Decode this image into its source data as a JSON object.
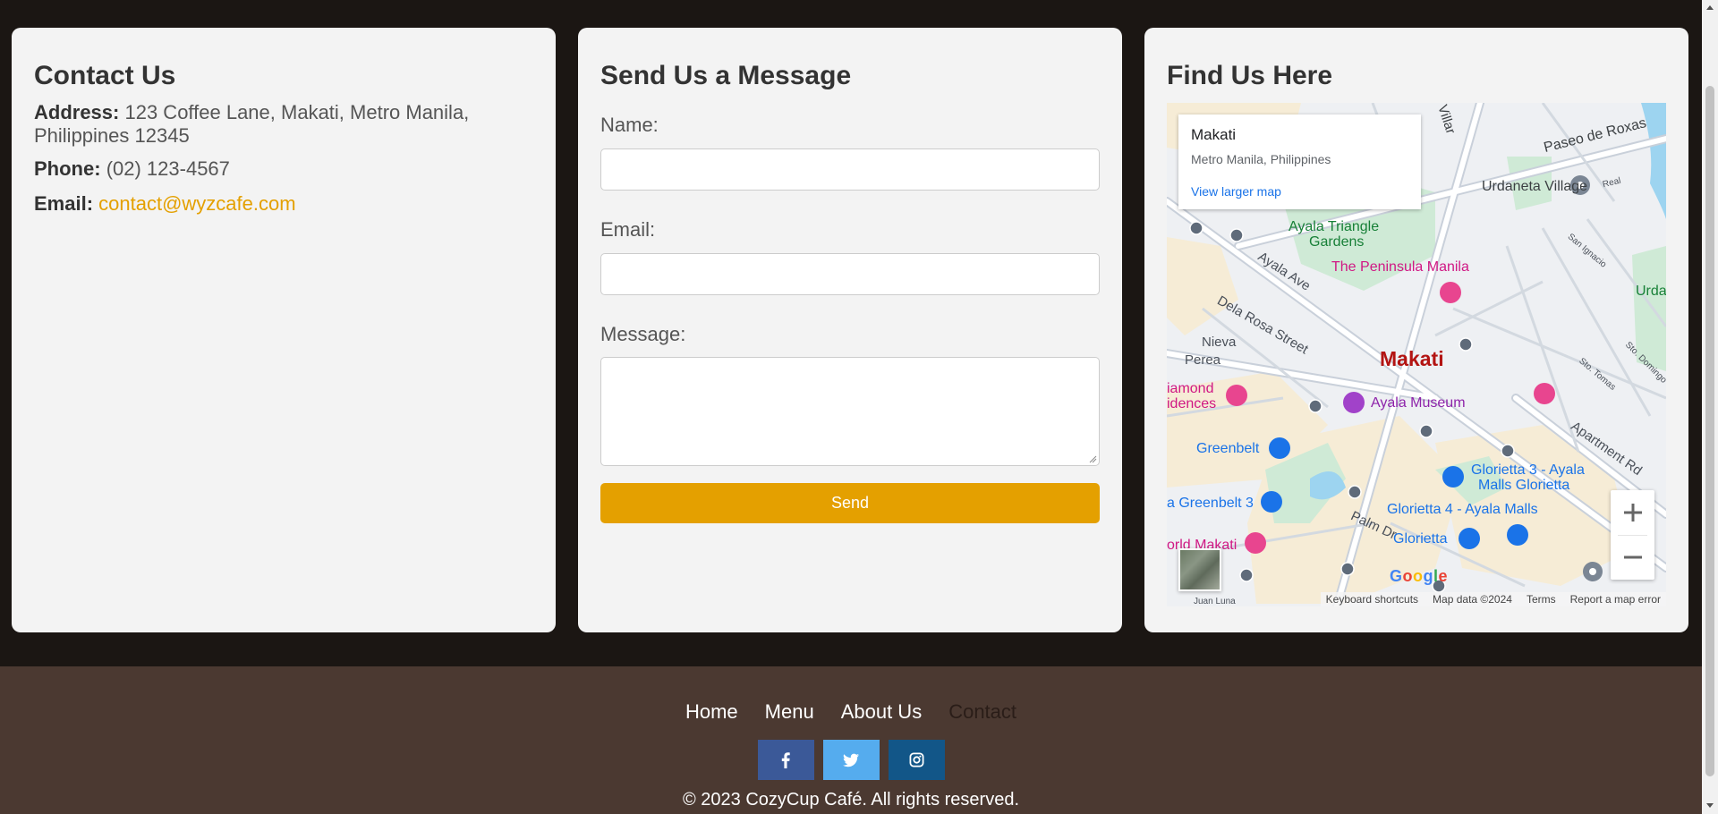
{
  "contact": {
    "title": "Contact Us",
    "address_label": "Address:",
    "address_value": "123 Coffee Lane, Makati, Metro Manila, Philippines 12345",
    "phone_label": "Phone:",
    "phone_value": "(02) 123-4567",
    "email_label": "Email:",
    "email_value": "contact@wyzcafe.com"
  },
  "form": {
    "title": "Send Us a Message",
    "name_label": "Name:",
    "name_value": "",
    "email_label": "Email:",
    "email_value": "",
    "message_label": "Message:",
    "message_value": "",
    "send_label": "Send",
    "accent_color": "#e4a000"
  },
  "map_section": {
    "title": "Find Us Here",
    "info_window": {
      "place": "Makati",
      "region": "Metro Manila, Philippines",
      "link": "View larger map"
    },
    "labels": {
      "villar": "Villar",
      "paseo": "Paseo de Roxas",
      "urdaneta_village": "Urdaneta Village",
      "real": "Real",
      "ayala_triangle": "Ayala Triangle",
      "gardens": "Gardens",
      "peninsula": "The Peninsula Manila",
      "urda": "Urda",
      "ayala_ave": "Ayala Ave",
      "san_ignacio": "San Ignacio",
      "dela_rosa": "Dela Rosa Street",
      "nieva": "Nieva",
      "perea": "Perea",
      "makati": "Makati",
      "sto_tomas": "Sto. Tomas",
      "sto_domingo": "Sto. Domingo",
      "diamond": "iamond",
      "idences": "idences",
      "ayala_museum": "Ayala Museum",
      "apartment_rd": "Apartment Rd",
      "greenbelt": "Greenbelt",
      "glorietta3": "Glorietta 3 - Ayala",
      "malls_glorietta": "Malls Glorietta",
      "greenbelt3": "a Greenbelt 3",
      "glorietta4": "Glorietta 4 - Ayala Malls",
      "palm_dr": "Palm Dr",
      "glorietta": "Glorietta",
      "world_makati": "orld Makati",
      "juan_luna": "Juan Luna"
    },
    "google_logo": "Google",
    "attribution": {
      "shortcuts": "Keyboard shortcuts",
      "data": "Map data ©2024",
      "terms": "Terms",
      "report": "Report a map error"
    }
  },
  "footer": {
    "nav": [
      "Home",
      "Menu",
      "About Us",
      "Contact"
    ],
    "active_nav": "Contact",
    "socials": [
      {
        "icon": "facebook-icon",
        "color": "#3b5998"
      },
      {
        "icon": "twitter-icon",
        "color": "#55acee"
      },
      {
        "icon": "instagram-icon",
        "color": "#125688"
      }
    ],
    "copyright": "© 2023 CozyCup Café. All rights reserved."
  }
}
